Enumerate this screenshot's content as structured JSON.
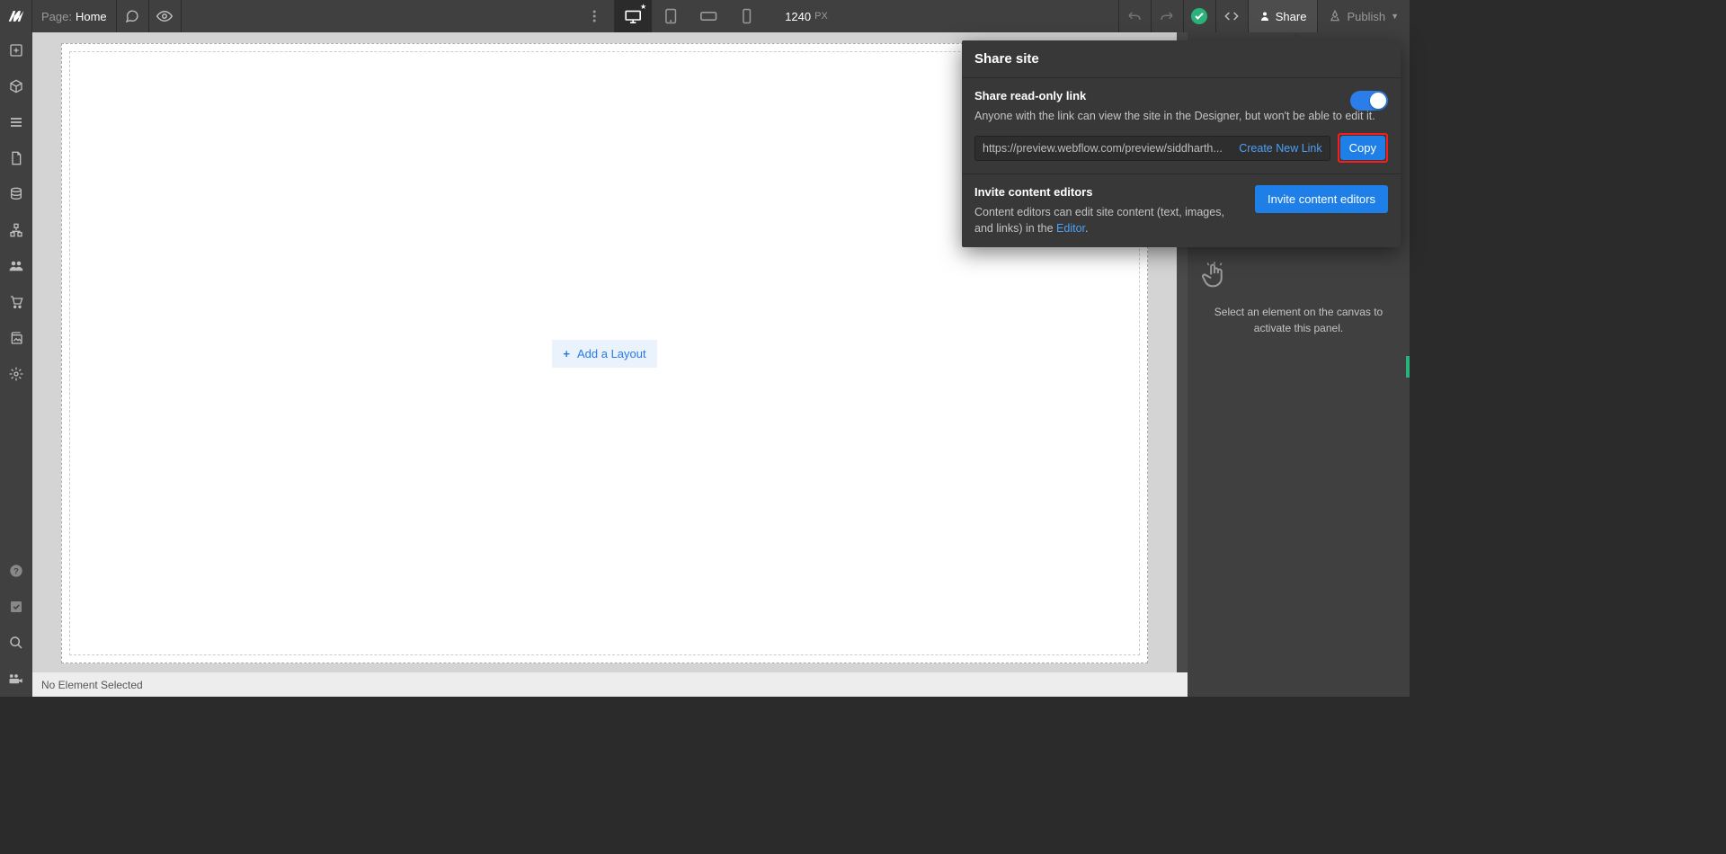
{
  "topbar": {
    "page_label": "Page:",
    "page_value": "Home",
    "canvas_width": "1240",
    "canvas_unit": "PX",
    "share_label": "Share",
    "publish_label": "Publish"
  },
  "canvas": {
    "add_layout_label": "Add a Layout"
  },
  "rightpanel": {
    "empty_text": "Select an element on the canvas to activate this panel."
  },
  "statusbar": {
    "selection_text": "No Element Selected"
  },
  "share_popover": {
    "title": "Share site",
    "readonly_title": "Share read-only link",
    "readonly_desc": "Anyone with the link can view the site in the Designer, but won't be able to edit it.",
    "link_url": "https://preview.webflow.com/preview/siddharth...",
    "create_new_link": "Create New Link",
    "copy_label": "Copy",
    "invite_title": "Invite content editors",
    "invite_desc_prefix": "Content editors can edit site content (text, images, and links) in the ",
    "invite_editor_link": "Editor",
    "invite_desc_suffix": ".",
    "invite_button": "Invite content editors"
  }
}
